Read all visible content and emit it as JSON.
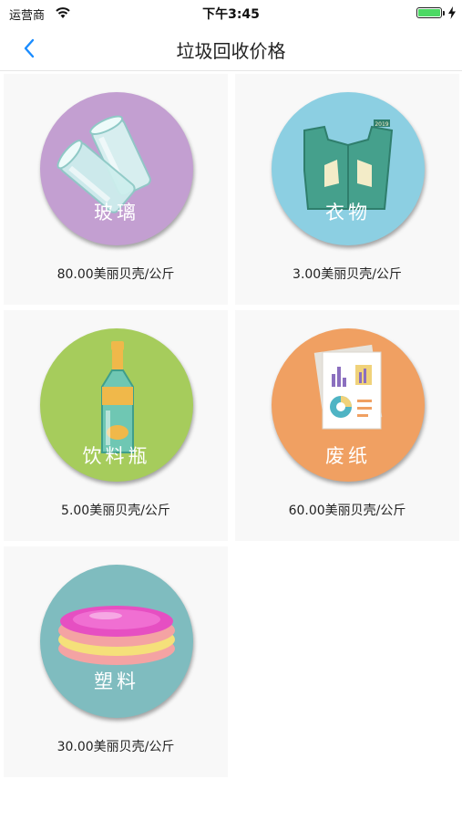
{
  "status_bar": {
    "carrier": "运营商",
    "time": "下午3:45",
    "battery_level": 1.0
  },
  "nav": {
    "title": "垃圾回收价格",
    "back_icon": "chevron-left-icon"
  },
  "colors": {
    "accent": "#1a8cff",
    "card_background": "#f8f8f8",
    "glass": "#c39fd1",
    "clothes": "#8ccfe2",
    "bottle": "#a6cc5c",
    "paper": "#f0a062",
    "plastic": "#7fbcbf"
  },
  "items": [
    {
      "label": "玻璃",
      "price": "80.00美丽贝壳/公斤",
      "icon": "glass-icon"
    },
    {
      "label": "衣物",
      "price": "3.00美丽贝壳/公斤",
      "icon": "clothes-icon"
    },
    {
      "label": "饮料瓶",
      "price": "5.00美丽贝壳/公斤",
      "icon": "bottle-icon"
    },
    {
      "label": "废纸",
      "price": "60.00美丽贝壳/公斤",
      "icon": "paper-icon"
    },
    {
      "label": "塑料",
      "price": "30.00美丽贝壳/公斤",
      "icon": "plastic-icon"
    }
  ]
}
